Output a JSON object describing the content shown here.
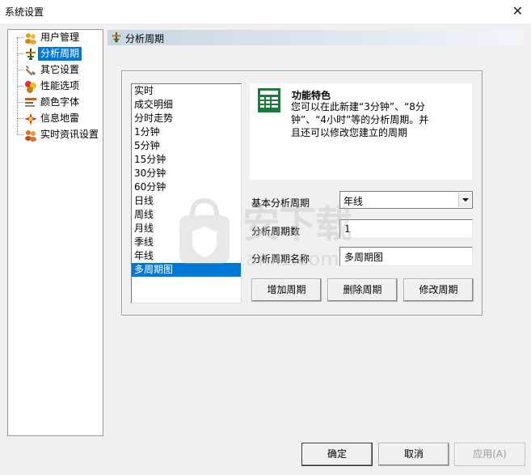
{
  "window": {
    "title": "系统设置",
    "close_glyph": "✕"
  },
  "tree": {
    "items": [
      {
        "label": "用户管理",
        "icon": "users-icon"
      },
      {
        "label": "分析周期",
        "icon": "period-icon"
      },
      {
        "label": "其它设置",
        "icon": "tools-icon"
      },
      {
        "label": "性能选项",
        "icon": "performance-icon"
      },
      {
        "label": "颜色字体",
        "icon": "font-color-icon"
      },
      {
        "label": "信息地雷",
        "icon": "info-mine-icon"
      },
      {
        "label": "实时资讯设置",
        "icon": "news-icon"
      }
    ],
    "selected_index": 1
  },
  "header": {
    "title": "分析周期"
  },
  "period_list": {
    "items": [
      "实时",
      "成交明细",
      "分时走势",
      "1分钟",
      "5分钟",
      "15分钟",
      "30分钟",
      "60分钟",
      "日线",
      "周线",
      "月线",
      "季线",
      "年线",
      "多周期图"
    ],
    "selected": "多周期图"
  },
  "feature": {
    "title": "功能特色",
    "description": "您可以在此新建“3分钟”、“8分钟”、“4小时”等的分析周期。并且还可以修改您建立的周期"
  },
  "form": {
    "base_period_label": "基本分析周期",
    "base_period_value": "年线",
    "count_label": "分析周期数",
    "count_value": "1",
    "name_label": "分析周期名称",
    "name_value": "多周期图"
  },
  "actions": {
    "add": "增加周期",
    "delete": "删除周期",
    "modify": "修改周期"
  },
  "footer": {
    "ok": "确定",
    "cancel": "取消",
    "apply": "应用(A)"
  },
  "watermark": {
    "text": "安下载",
    "domain": "anxz.com"
  }
}
